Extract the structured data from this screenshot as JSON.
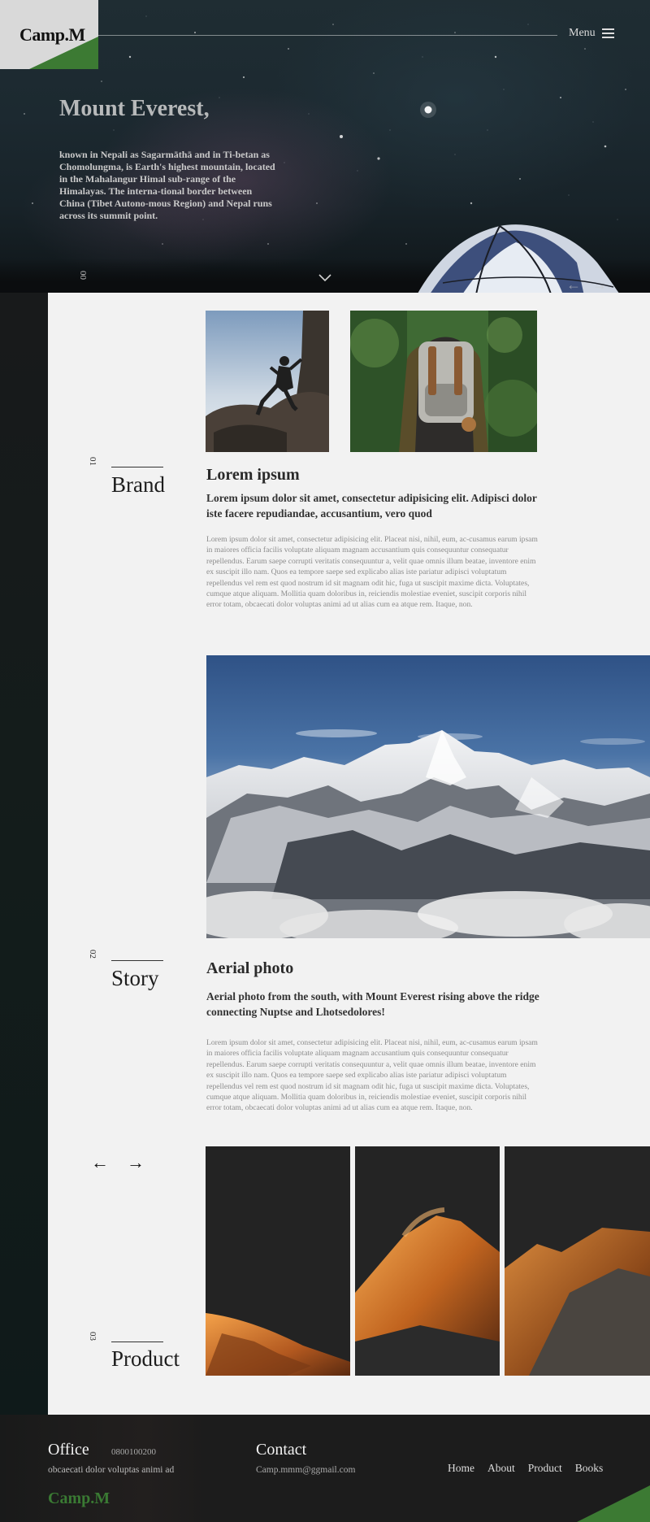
{
  "header": {
    "logo": "Camp.M",
    "menu_label": "Menu"
  },
  "hero": {
    "title": "Mount Everest,",
    "description": "known in Nepali as Sagarmāthā and in Ti-betan as Chomolungma, is Earth's highest mountain, located in the Mahalangur Himal sub-range of  the Himalayas. The interna-tional border between China (Tibet Autono-mous Region) and Nepal runs across its summit point.",
    "index": "00"
  },
  "sections": [
    {
      "index": "01",
      "label": "Brand",
      "title": "Lorem ipsum",
      "lead": "Lorem ipsum dolor sit amet, consectetur adipisicing elit. Adipisci dolor iste facere repudiandae, accusantium, vero quod",
      "body": "Lorem ipsum dolor sit amet, consectetur adipisicing elit. Placeat nisi, nihil, eum, ac-cusamus earum ipsam in maiores officia facilis voluptate aliquam magnam accusantium quis consequuntur consequatur repellendus. Earum saepe corrupti veritatis consequuntur a, velit quae omnis illum beatae, inventore enim ex suscipit illo nam. Quos ea tempore saepe sed explicabo alias iste pariatur adipisci voluptatum repellendus vel rem est quod nostrum id sit magnam odit hic, fuga ut suscipit maxime dicta. Voluptates, cumque atque aliquam. Mollitia quam doloribus in, reiciendis molestiae eveniet, suscipit corporis nihil error totam, obcaecati dolor voluptas animi ad ut alias cum ea atque rem. Itaque, non."
    },
    {
      "index": "02",
      "label": "Story",
      "title": "Aerial photo",
      "lead": "Aerial photo from the south, with Mount Everest rising above the ridge connecting Nuptse and Lhotsedolores!",
      "body": "Lorem ipsum dolor sit amet, consectetur adipisicing elit. Placeat nisi, nihil, eum, ac-cusamus earum ipsam in maiores officia facilis voluptate aliquam magnam accusantium quis consequuntur consequatur repellendus. Earum saepe corrupti veritatis consequuntur a, velit quae omnis illum beatae, inventore enim ex suscipit illo nam. Quos ea tempore saepe sed explicabo alias iste pariatur adipisci voluptatum repellendus vel rem est quod nostrum id sit magnam odit hic, fuga ut suscipit maxime dicta. Voluptates, cumque atque aliquam. Mollitia quam doloribus in, reiciendis molestiae eveniet, suscipit corporis nihil error totam, obcaecati dolor voluptas animi ad ut alias cum ea atque rem. Itaque, non."
    },
    {
      "index": "03",
      "label": "Product"
    }
  ],
  "icons": {
    "menu": "hamburger-icon",
    "scroll": "chevron-down-icon",
    "prev": "arrow-left-icon",
    "next": "arrow-right-icon"
  },
  "footer": {
    "office_title": "Office",
    "phone": "0800100200",
    "office_note": "obcaecati dolor voluptas animi ad",
    "logo": "Camp.M",
    "contact_title": "Contact",
    "email": "Camp.mmm@ggmail.com",
    "nav": [
      "Home",
      "About",
      "Product",
      "Books"
    ]
  },
  "colors": {
    "brand_green": "#3c7a33",
    "panel_bg": "#f2f2f2",
    "dark_bg": "#1c1c1c"
  }
}
